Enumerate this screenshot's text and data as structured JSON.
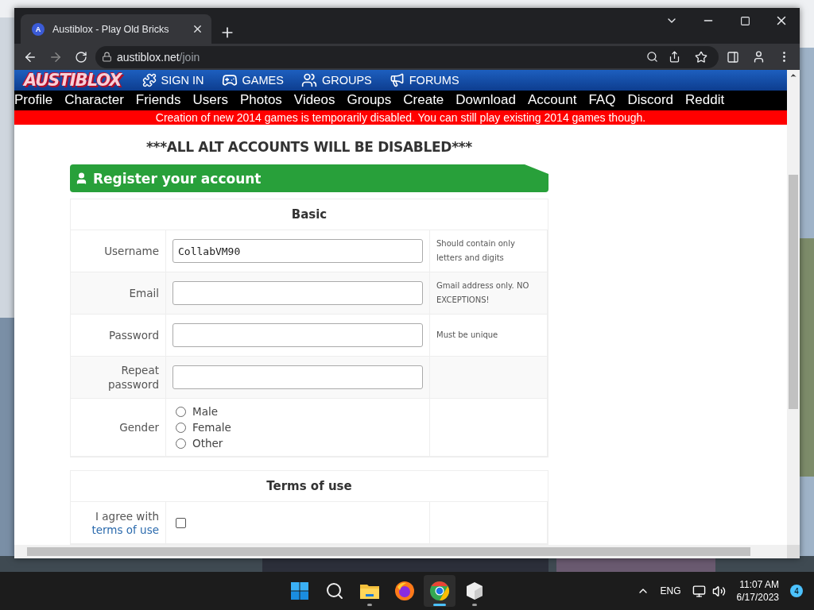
{
  "browser": {
    "tab": {
      "favicon_letter": "A",
      "title": "Austiblox - Play Old Bricks"
    },
    "url": {
      "host": "austiblox.net",
      "path": "/join"
    }
  },
  "site": {
    "logo": "AUSTIBLOX",
    "nav": [
      {
        "kind": "signin",
        "label": "SIGN IN"
      },
      {
        "kind": "games",
        "label": "GAMES"
      },
      {
        "kind": "groups",
        "label": "GROUPS"
      },
      {
        "kind": "forums",
        "label": "FORUMS"
      }
    ],
    "menu": [
      "Profile",
      "Character",
      "Friends",
      "Users",
      "Photos",
      "Videos",
      "Groups",
      "Create",
      "Download",
      "Account",
      "FAQ",
      "Discord",
      "Reddit"
    ],
    "banner": "Creation of new 2014 games is temporarily disabled. You can still play existing 2014 games though.",
    "notice": "***ALL ALT ACCOUNTS WILL BE DISABLED***"
  },
  "form": {
    "title": "Register your account",
    "sections": [
      {
        "title": "Basic",
        "rows": [
          {
            "kind": "text",
            "label": "Username",
            "value": "CollabVM90",
            "hint": "Should contain only letters and digits"
          },
          {
            "kind": "text",
            "label": "Email",
            "hint": "Gmail address only. NO EXCEPTIONS!"
          },
          {
            "kind": "text",
            "label": "Password",
            "hint": "Must be unique"
          },
          {
            "kind": "text",
            "label": "Repeat password"
          },
          {
            "kind": "radio",
            "label": "Gender",
            "options": [
              {
                "label": "Male",
                "selected": false
              },
              {
                "label": "Female",
                "selected": false
              },
              {
                "label": "Other",
                "selected": false
              }
            ]
          }
        ]
      },
      {
        "title": "Terms of use",
        "rows": [
          {
            "kind": "checkbox",
            "label": "I agree with",
            "link": "terms of use",
            "checked": false
          }
        ]
      }
    ]
  },
  "taskbar": {
    "apps": [
      {
        "kind": "start",
        "running": false,
        "active": false
      },
      {
        "kind": "search",
        "running": false,
        "active": false
      },
      {
        "kind": "files",
        "running": true,
        "active": false
      },
      {
        "kind": "firefox",
        "running": false,
        "active": false
      },
      {
        "kind": "chrome",
        "running": true,
        "active": true
      },
      {
        "kind": "cube",
        "running": true,
        "active": false
      }
    ],
    "language": "ENG",
    "time": "11:07 AM",
    "date": "6/17/2023",
    "notifications": "4"
  }
}
